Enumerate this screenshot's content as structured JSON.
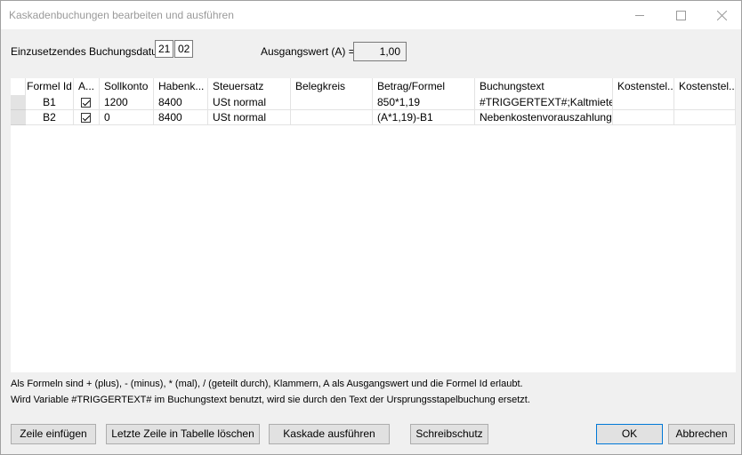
{
  "window": {
    "title": "Kaskadenbuchungen bearbeiten und ausführen"
  },
  "form": {
    "date_label": "Einzusetzendes Buchungsdatum:",
    "date_day": "21",
    "date_month": "02",
    "ausgangswert_label": "Ausgangswert (A) =",
    "ausgangswert_value": "1,00"
  },
  "table": {
    "headers": [
      "Formel Id",
      "A...",
      "Sollkonto",
      "Habenk...",
      "Steuersatz",
      "Belegkreis",
      "Betrag/Formel",
      "Buchungstext",
      "Kostenstel...",
      "Kostenstel..."
    ],
    "rows": [
      {
        "formel_id": "B1",
        "active": true,
        "sollkonto": "1200",
        "habenkonto": "8400",
        "steuersatz": "USt normal",
        "belegkreis": "",
        "betrag": "850*1,19",
        "buchungstext": "#TRIGGERTEXT#;Kaltmiete",
        "kst1": "",
        "kst2": ""
      },
      {
        "formel_id": "B2",
        "active": true,
        "sollkonto": "0",
        "habenkonto": "8400",
        "steuersatz": "USt normal",
        "belegkreis": "",
        "betrag": "(A*1,19)-B1",
        "buchungstext": "Nebenkostenvorauszahlung",
        "kst1": "",
        "kst2": ""
      }
    ]
  },
  "info": {
    "line1": "Als Formeln sind + (plus), - (minus), * (mal), / (geteilt durch), Klammern, A als Ausgangswert und die Formel Id erlaubt.",
    "line2": "Wird Variable #TRIGGERTEXT# im Buchungstext benutzt, wird sie durch den Text der Ursprungsstapelbuchung ersetzt."
  },
  "buttons": {
    "insert_row": "Zeile einfügen",
    "delete_last_row": "Letzte Zeile in Tabelle löschen",
    "run_cascade": "Kaskade ausführen",
    "write_protect": "Schreibschutz",
    "ok": "OK",
    "cancel": "Abbrechen"
  }
}
